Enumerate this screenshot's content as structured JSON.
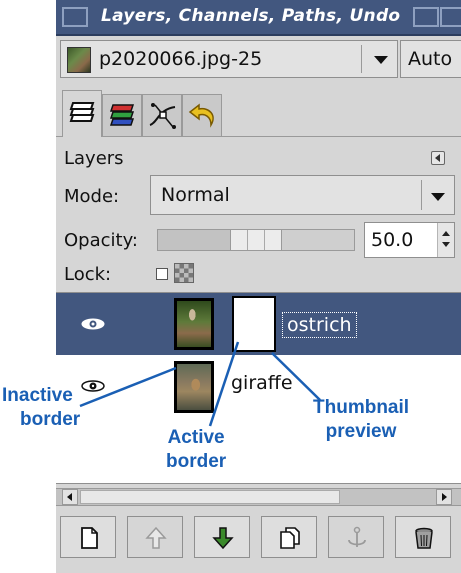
{
  "window": {
    "title": "Layers, Channels, Paths, Undo"
  },
  "image_selector": {
    "value": "p2020066.jpg-25",
    "auto_label": "Auto"
  },
  "tabs": [
    {
      "icon": "layers-icon"
    },
    {
      "icon": "channels-icon"
    },
    {
      "icon": "paths-icon"
    },
    {
      "icon": "undo-icon"
    }
  ],
  "layers_dialog": {
    "title": "Layers",
    "mode_label": "Mode:",
    "mode_value": "Normal",
    "opacity_label": "Opacity:",
    "opacity_value": "50.0",
    "opacity_fraction": 0.5,
    "lock_label": "Lock:",
    "lock_alpha_checked": false
  },
  "layers": [
    {
      "name": "ostrich",
      "visible": true,
      "selected": true,
      "has_mask": true
    },
    {
      "name": "giraffe",
      "visible": true,
      "selected": false,
      "has_mask": false
    }
  ],
  "toolbar": [
    {
      "icon": "new-layer-icon",
      "enabled": true
    },
    {
      "icon": "raise-layer-icon",
      "enabled": false
    },
    {
      "icon": "lower-layer-icon",
      "enabled": true
    },
    {
      "icon": "duplicate-layer-icon",
      "enabled": true
    },
    {
      "icon": "anchor-layer-icon",
      "enabled": false
    },
    {
      "icon": "delete-layer-icon",
      "enabled": true
    }
  ],
  "annotations": {
    "inactive_border": [
      "Inactive",
      "border"
    ],
    "active_border": [
      "Active",
      "border"
    ],
    "thumbnail_preview": [
      "Thumbnail",
      "preview"
    ]
  },
  "colors": {
    "titlebar": "#42577f",
    "selected_row": "#42577f",
    "annotation": "#1a5fb4"
  }
}
